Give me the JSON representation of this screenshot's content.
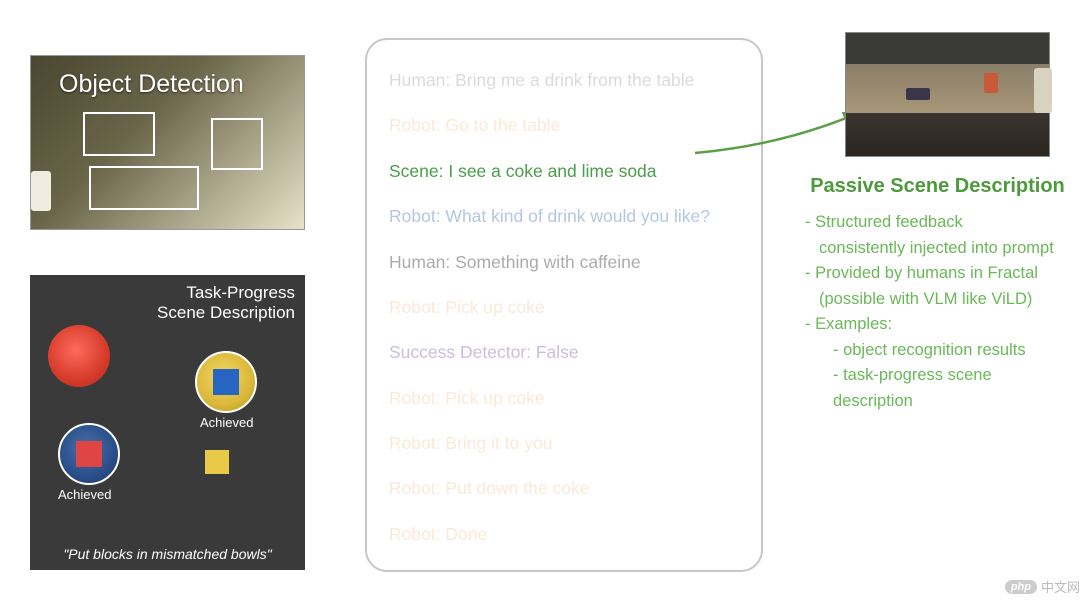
{
  "left": {
    "object_detection_label": "Object Detection",
    "task_progress_label_line1": "Task-Progress",
    "task_progress_label_line2": "Scene Description",
    "achieved_label": "Achieved",
    "task_caption": "\"Put blocks in mismatched bowls\""
  },
  "dialog": {
    "lines": [
      {
        "text": "Human: Bring me a drink from the table",
        "cls": "c-human fade"
      },
      {
        "text": "Robot: Go to the table",
        "cls": "c-robot fade"
      },
      {
        "text": "Scene: I see a coke and lime soda",
        "cls": "c-scene"
      },
      {
        "text": "Robot: What kind of drink would you like?",
        "cls": "c-robot-blue lighten"
      },
      {
        "text": "Human: Something with caffeine",
        "cls": "c-human lighten"
      },
      {
        "text": "Robot: Pick up coke",
        "cls": "c-robot fade"
      },
      {
        "text": "Success Detector: False",
        "cls": "c-success lighten"
      },
      {
        "text": "Robot: Pick up coke",
        "cls": "c-robot fade"
      },
      {
        "text": "Robot: Bring it to you",
        "cls": "c-robot fade"
      },
      {
        "text": "Robot: Put down the coke",
        "cls": "c-robot fade"
      },
      {
        "text": "Robot: Done",
        "cls": "c-robot fade"
      }
    ]
  },
  "right": {
    "title": "Passive Scene Description",
    "bullets": [
      "- Structured feedback",
      "  consistently injected into prompt",
      "- Provided by humans in Fractal",
      "  (possible with VLM like ViLD)",
      "- Examples:",
      "    - object recognition results",
      "    - task-progress scene description"
    ]
  },
  "watermark": {
    "badge": "php",
    "text": "中文网"
  },
  "colors": {
    "scene_green": "#4a9d4a",
    "right_green": "#5aa84a",
    "arrow_green": "#5a9e48"
  }
}
